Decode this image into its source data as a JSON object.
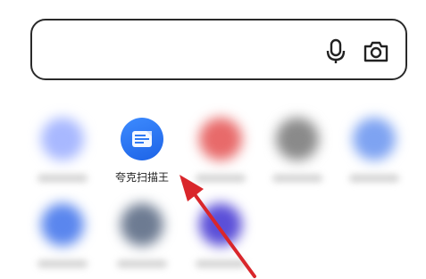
{
  "search": {
    "value": "",
    "placeholder": ""
  },
  "apps": [
    {
      "label": "夸克扫描王",
      "icon": "document-scan-icon",
      "color": "#2f7af3"
    }
  ],
  "blurred_app_colors": [
    "#a8b8ff",
    "#e86a6a",
    "#8a8a8a",
    "#7ea3f2",
    "#5a86ee",
    "#6d7b92",
    "#5b4fd8"
  ],
  "annotation": {
    "color": "#d9262b"
  }
}
